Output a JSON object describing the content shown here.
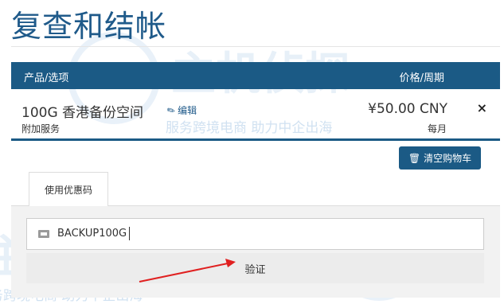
{
  "page": {
    "title": "复查和结帐"
  },
  "watermark": {
    "brand": "主机侦探",
    "slogan": "服务跨境电商 助力中企出海"
  },
  "cart": {
    "header": {
      "product": "产品/选项",
      "price": "价格/周期"
    },
    "item": {
      "name": "100G 香港备份空间",
      "edit_label": "编辑",
      "group": "附加服务",
      "price": "¥50.00 CNY",
      "cycle": "每月",
      "remove_symbol": "×"
    },
    "clear_label": "清空购物车"
  },
  "promo": {
    "tab_label": "使用优惠码",
    "code_value": "BACKUP100G",
    "verify_label": "验证"
  },
  "colors": {
    "accent": "#1b5a85",
    "title": "#1f5a8a",
    "arrow": "#e02020"
  }
}
